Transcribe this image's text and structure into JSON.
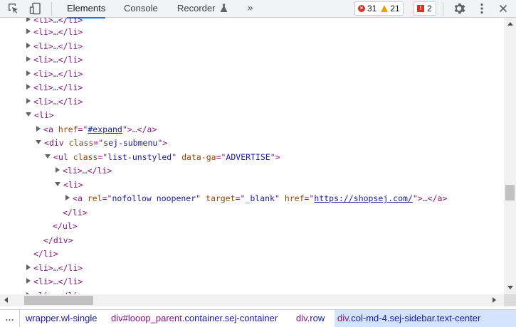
{
  "toolbar": {
    "tabs": [
      {
        "label": "Elements",
        "active": true
      },
      {
        "label": "Console",
        "active": false
      },
      {
        "label": "Recorder",
        "active": false
      }
    ],
    "more_tabs": "»",
    "errors": "31",
    "warnings": "21",
    "issues": "2"
  },
  "tree": {
    "ellipsis": "…",
    "li": "li",
    "a": "a",
    "div": "div",
    "ul": "ul",
    "attr_href": "href",
    "val_expand": "#expand",
    "attr_class": "class",
    "val_submenu": "sej-submenu",
    "val_list": "list-unstyled",
    "attr_data_ga": "data-ga",
    "val_advertise": "ADVERTISE",
    "attr_rel": "rel",
    "val_rel": "nofollow noopener",
    "attr_target": "target",
    "val_target": "_blank",
    "val_shop": "https://shopsej.com/"
  },
  "breadcrumb": {
    "more": "…",
    "items": [
      {
        "tag": "",
        "id": "",
        "cls": "wrapper.wl-single",
        "prefix": ""
      },
      {
        "tag": "div",
        "id": "#looop_parent",
        "cls": ".container.sej-container"
      },
      {
        "tag": "div",
        "id": "",
        "cls": ".row"
      },
      {
        "tag": "div",
        "id": "",
        "cls": ".col-md-4.sej-sidebar.text-center"
      }
    ]
  },
  "colors": {
    "tag": "#881280",
    "attr_name": "#994500",
    "attr_value": "#1a1aa6",
    "tab_underline": "#1a73e8",
    "error": "#d93025",
    "warning": "#e8a200"
  }
}
